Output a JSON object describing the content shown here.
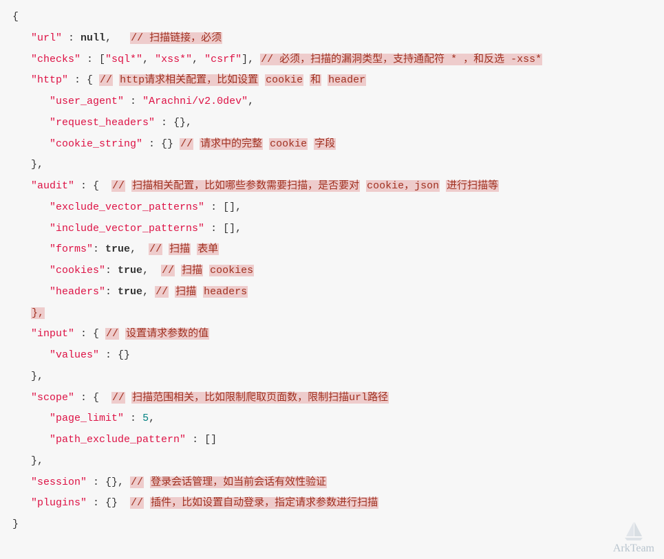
{
  "code": {
    "l1": "{",
    "l2_key": "\"url\"",
    "l2_mid": " : ",
    "l2_null": "null",
    "l2_c": ",",
    "l2_cmt": "// 扫描链接，必须",
    "l3_key": "\"checks\"",
    "l3_mid": " : [",
    "l3_s1": "\"sql*\"",
    "l3_s2": "\"xss*\"",
    "l3_s3": "\"csrf\"",
    "l3_end": "],",
    "l3_cmt": "// 必须，扫描的漏洞类型，支持通配符 * ，和反选 -xss*",
    "l4_key": "\"http\"",
    "l4_mid": " : { ",
    "l4_cmt1": "//",
    "l4_cmt2": "http请求相关配置，比如设置",
    "l4_cmt3": "cookie",
    "l4_cmt4": "和",
    "l4_cmt5": "header",
    "l5_key": "\"user_agent\"",
    "l5_mid": " : ",
    "l5_val": "\"Arachni/v2.0dev\"",
    "l5_c": ",",
    "l6_key": "\"request_headers\"",
    "l6_mid": " : {},",
    "l7_key": "\"cookie_string\"",
    "l7_mid": " : {} ",
    "l7_cmt1": "//",
    "l7_cmt2": "请求中的完整",
    "l7_cmt3": "cookie",
    "l7_cmt4": "字段",
    "l8": "},",
    "l9_key": "\"audit\"",
    "l9_mid": " : {  ",
    "l9_cmt1": "//",
    "l9_cmt2": "扫描相关配置，比如哪些参数需要扫描，是否要对",
    "l9_cmt3": "cookie，json",
    "l9_cmt4": "进行扫描等",
    "l10_key": "\"exclude_vector_patterns\"",
    "l10_mid": " : [],",
    "l11_key": "\"include_vector_patterns\"",
    "l11_mid": " : [],",
    "l12_key": "\"forms\"",
    "l12_mid": ": ",
    "l12_val": "true",
    "l12_c": ",  ",
    "l12_cmt1": "//",
    "l12_cmt2": "扫描",
    "l12_cmt3": "表单",
    "l13_key": "\"cookies\"",
    "l13_mid": ": ",
    "l13_val": "true",
    "l13_c": ",  ",
    "l13_cmt1": "//",
    "l13_cmt2": "扫描",
    "l13_cmt3": "cookies",
    "l14_key": "\"headers\"",
    "l14_mid": ": ",
    "l14_val": "true",
    "l14_c": ", ",
    "l14_cmt1": "//",
    "l14_cmt2": "扫描",
    "l14_cmt3": "headers",
    "l15": "},",
    "l16_key": "\"input\"",
    "l16_mid": " : { ",
    "l16_cmt1": "//",
    "l16_cmt2": "设置请求参数的值",
    "l17_key": "\"values\"",
    "l17_mid": " : {}",
    "l18": "},",
    "l19_key": "\"scope\"",
    "l19_mid": " : {  ",
    "l19_cmt1": "//",
    "l19_cmt2": "扫描范围相关，比如限制爬取页面数，限制扫描url路径",
    "l20_key": "\"page_limit\"",
    "l20_mid": " : ",
    "l20_val": "5",
    "l20_c": ",",
    "l21_key": "\"path_exclude_pattern\"",
    "l21_mid": " : []",
    "l22": "},",
    "l23_key": "\"session\"",
    "l23_mid": " : {}, ",
    "l23_cmt1": "//",
    "l23_cmt2": "登录会话管理，如当前会话有效性验证",
    "l24_key": "\"plugins\"",
    "l24_mid": " : {}  ",
    "l24_cmt1": "//",
    "l24_cmt2": "插件，比如设置自动登录，指定请求参数进行扫描",
    "l25": "}"
  },
  "watermark": "ArkTeam"
}
